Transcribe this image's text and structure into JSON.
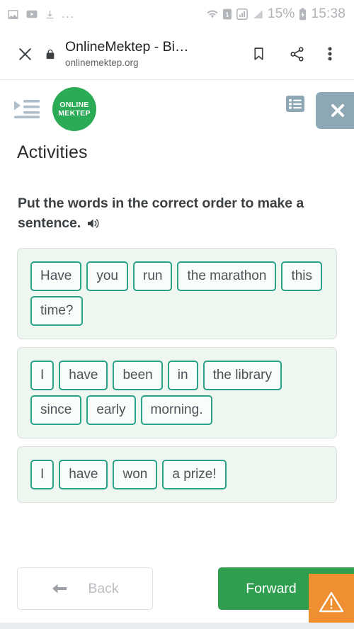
{
  "status_bar": {
    "left_icons": [
      "image-icon",
      "video-icon",
      "download-icon"
    ],
    "overflow": "...",
    "right_icons": [
      "wifi-icon",
      "sim-1-icon",
      "signal-bars-icon",
      "signal-triangle-icon",
      "battery-charging-icon"
    ],
    "battery_percent": "15%",
    "clock": "15:38"
  },
  "browser_bar": {
    "close_icon": "close-icon",
    "lock_icon": "lock-icon",
    "title": "OnlineMektep - Bi…",
    "url": "onlinemektep.org",
    "bookmark_icon": "bookmark-icon",
    "share_icon": "share-icon",
    "more_icon": "more-vertical-icon"
  },
  "app_header": {
    "menu_icon": "sidebar-expand-icon",
    "logo_line1": "ONLINE",
    "logo_line2": "MEKTEP",
    "logo_color": "#2bab55",
    "list_icon": "list-view-icon",
    "close_icon": "close-icon",
    "close_bg": "#8ea7b5"
  },
  "page": {
    "title": "Activities",
    "instruction": "Put the words in the correct order to make a sentence.",
    "speaker_icon": "speaker-icon"
  },
  "cards": [
    {
      "tiles": [
        "Have",
        "you",
        "run",
        "the marathon",
        "this",
        "time?"
      ]
    },
    {
      "tiles": [
        "I",
        "have",
        "been",
        "in",
        "the library",
        "since",
        "early",
        "morning."
      ]
    },
    {
      "tiles": [
        "I",
        "have",
        "won",
        "a prize!"
      ]
    }
  ],
  "footer": {
    "back_label": "Back",
    "back_icon": "arrow-left-icon",
    "back_disabled": true,
    "forward_label": "Forward",
    "forward_icon": "arrow-right-icon",
    "forward_color": "#2f9e4f",
    "warning_icon": "warning-triangle-icon",
    "warning_color": "#ef8f32"
  },
  "colors": {
    "tile_border": "#2aa189",
    "card_bg": "#edf7f0",
    "accent_green": "#2f9e4f"
  }
}
